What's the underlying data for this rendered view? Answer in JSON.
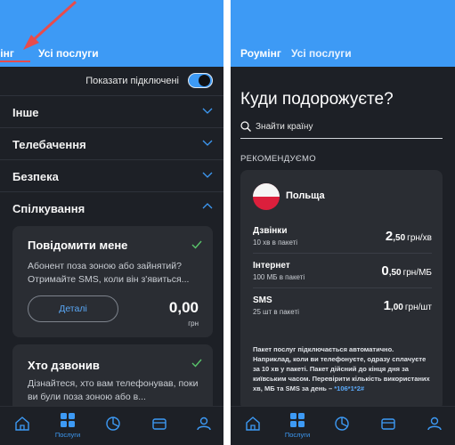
{
  "left_screen": {
    "tabs": [
      "Роумінг",
      "Усі послуги"
    ],
    "toggle_label": "Показати підключені",
    "sections": [
      "Інше",
      "Телебачення",
      "Безпека",
      "Спілкування"
    ],
    "cards": [
      {
        "title": "Повідомити мене",
        "description": "Абонент поза зоною або зайнятий? Отримайте SMS, коли він з'явиться...",
        "details_label": "Деталі",
        "price": "0,00",
        "price_unit": "грн"
      },
      {
        "title": "Хто дзвонив",
        "description": "Дізнайтеся, хто вам телефонував, поки ви були поза зоною або в..."
      }
    ],
    "nav_active_label": "Послуги"
  },
  "right_screen": {
    "tabs": [
      "Роумінг",
      "Усі послуги"
    ],
    "title": "Куди подорожуєте?",
    "search_placeholder": "Знайти країну",
    "recommended_label": "РЕКОМЕНДУЄМО",
    "country": "Польща",
    "tariffs": [
      {
        "name": "Дзвінки",
        "sub": "10 хв в пакеті",
        "price_whole": "2",
        "price_frac": ",50",
        "unit": "грн/хв"
      },
      {
        "name": "Інтернет",
        "sub": "100 МБ в пакеті",
        "price_whole": "0",
        "price_frac": ",50",
        "unit": "грн/МБ"
      },
      {
        "name": "SMS",
        "sub": "25 шт в пакеті",
        "price_whole": "1",
        "price_frac": ",00",
        "unit": "грн/шт"
      }
    ],
    "note": "Пакет послуг підключається автоматично. Наприклад, коли ви телефонуєте, одразу сплачуєте за 10 хв у пакеті. Пакет дійсний до кінця дня за київським часом. Перевірити кількість використаних хв, МБ та SMS за день –",
    "note_code": "*106*1*2#",
    "nav_active_label": "Послуги"
  },
  "colors": {
    "accent": "#3d9af5",
    "background": "#1d2026",
    "card": "#2a2d33",
    "annotation_arrow": "#e74c4c",
    "check": "#59c46b"
  }
}
